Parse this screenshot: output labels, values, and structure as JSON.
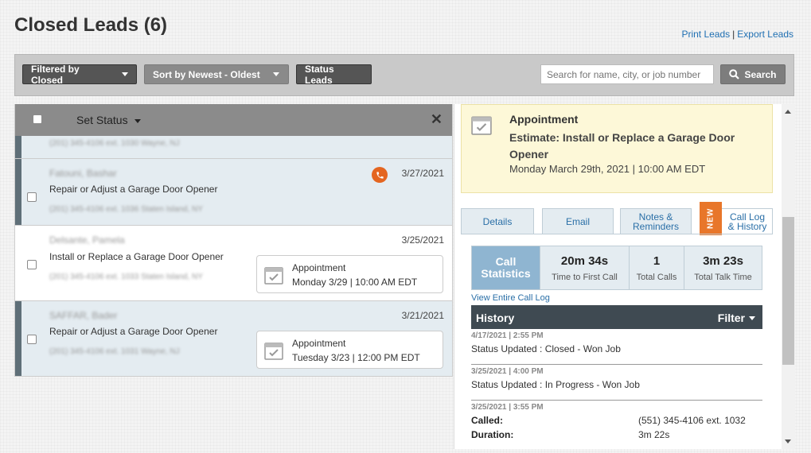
{
  "page": {
    "title": "Closed Leads (6)"
  },
  "header": {
    "print_label": "Print Leads",
    "separator": "|",
    "export_label": "Export Leads"
  },
  "toolbar": {
    "filter_label": "Filtered by Closed",
    "sort_label": "Sort by Newest - Oldest",
    "status_label": "Status Leads",
    "search_placeholder": "Search for name, city, or job number",
    "search_button": "Search"
  },
  "list": {
    "set_status_label": "Set Status",
    "close_glyph": "✕",
    "rows": [
      {
        "name": "Fatouni, Bashar",
        "type": "Repair or Adjust a Garage Door Opener",
        "address": "(201) 345-4106 ext. 1036 Staten Island, NY",
        "date": "3/27/2021"
      },
      {
        "name": "Delsante, Pamela",
        "type": "Install or Replace a Garage Door Opener",
        "address": "(201) 345-4106 ext. 1033 Staten Island, NY",
        "date": "3/25/2021",
        "appt_label": "Appointment",
        "appt_time": "Monday 3/29 | 10:00 AM EDT"
      },
      {
        "name": "SAFFAR, Bader",
        "type": "Repair or Adjust a Garage Door Opener",
        "address": "(201) 345-4106 ext. 1031 Wayne, NJ",
        "date": "3/21/2021",
        "appt_label": "Appointment",
        "appt_time": "Tuesday 3/23 | 12:00 PM EDT"
      }
    ],
    "partial_row_address": "(201) 345-4106 ext. 1030 Wayne, NJ"
  },
  "detail": {
    "appointment": {
      "label": "Appointment",
      "title": "Estimate: Install or Replace a Garage Door Opener",
      "datetime": "Monday March 29th, 2021 | 10:00 AM EDT"
    },
    "tabs": {
      "details": "Details",
      "email": "Email",
      "notes": "Notes & Reminders",
      "new_badge": "NEW",
      "call_log": "Call Log & History"
    },
    "call_stats": {
      "heading": "Call Statistics",
      "items": [
        {
          "value": "20m 34s",
          "label": "Time to First Call"
        },
        {
          "value": "1",
          "label": "Total Calls"
        },
        {
          "value": "3m 23s",
          "label": "Total Talk Time"
        }
      ],
      "view_link": "View Entire Call Log"
    },
    "history": {
      "title": "History",
      "filter_label": "Filter",
      "entries": [
        {
          "timestamp": "4/17/2021 | 2:55 PM",
          "text": "Status Updated : Closed - Won Job"
        },
        {
          "timestamp": "3/25/2021 | 4:00 PM",
          "text": "Status Updated : In Progress - Won Job"
        }
      ],
      "call_entry": {
        "timestamp": "3/25/2021 | 3:55 PM",
        "called_label": "Called:",
        "called_value": "(551) 345-4106 ext. 1032",
        "duration_label": "Duration:",
        "duration_value": "3m 22s"
      }
    }
  },
  "colors": {
    "accent_blue": "#2a6fa7",
    "phone_orange": "#e46520",
    "appt_yellow": "#fdf8d8"
  }
}
